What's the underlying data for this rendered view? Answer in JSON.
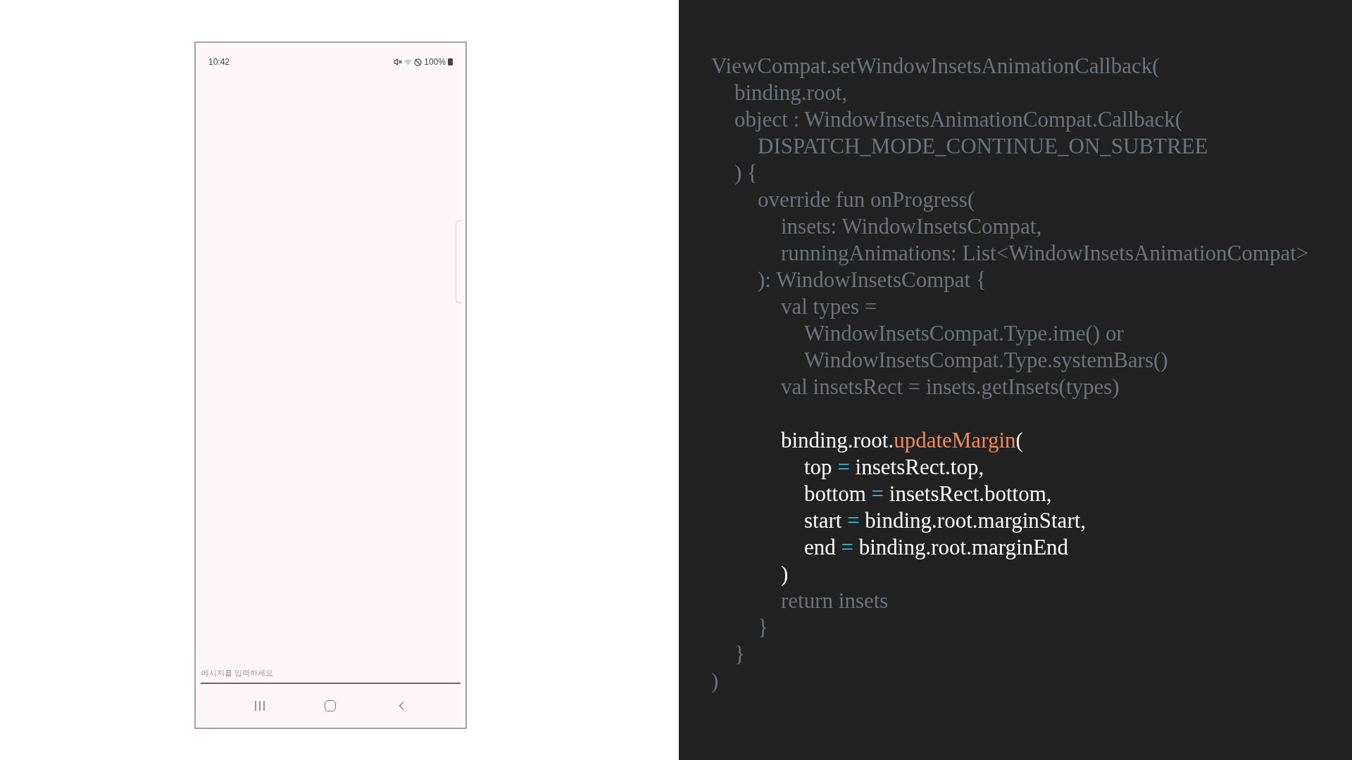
{
  "phone": {
    "status_bar": {
      "time": "10:42",
      "battery": "100%"
    },
    "message_field": {
      "placeholder": "메시지를 입력하세요"
    }
  },
  "code": {
    "lines": [
      {
        "highlighted": false,
        "segments": [
          {
            "kind": "plain",
            "text": "ViewCompat.setWindowInsetsAnimationCallback("
          }
        ],
        "children": [
          {
            "highlighted": false,
            "segments": [
              {
                "kind": "plain",
                "text": "binding.root,"
              }
            ]
          },
          {
            "highlighted": false,
            "segments": [
              {
                "kind": "plain",
                "text": "object : WindowInsetsAnimationCompat.Callback("
              }
            ],
            "children": [
              {
                "highlighted": false,
                "segments": [
                  {
                    "kind": "plain",
                    "text": "DISPATCH_MODE_CONTINUE_ON_SUBTREE"
                  }
                ]
              }
            ]
          },
          {
            "highlighted": false,
            "segments": [
              {
                "kind": "plain",
                "text": ") {"
              }
            ],
            "children": [
              {
                "highlighted": false,
                "segments": [
                  {
                    "kind": "plain",
                    "text": "override fun onProgress("
                  }
                ],
                "children": [
                  {
                    "highlighted": false,
                    "segments": [
                      {
                        "kind": "plain",
                        "text": "insets: WindowInsetsCompat,"
                      }
                    ]
                  },
                  {
                    "highlighted": false,
                    "segments": [
                      {
                        "kind": "plain",
                        "text": "runningAnimations: List<WindowInsetsAnimationCompat>"
                      }
                    ]
                  }
                ]
              },
              {
                "highlighted": false,
                "segments": [
                  {
                    "kind": "plain",
                    "text": "): WindowInsetsCompat {"
                  }
                ],
                "children": [
                  {
                    "highlighted": false,
                    "segments": [
                      {
                        "kind": "plain",
                        "text": "val types ="
                      }
                    ],
                    "children": [
                      {
                        "highlighted": false,
                        "segments": [
                          {
                            "kind": "plain",
                            "text": "WindowInsetsCompat.Type.ime() or"
                          }
                        ]
                      },
                      {
                        "highlighted": false,
                        "segments": [
                          {
                            "kind": "plain",
                            "text": "WindowInsetsCompat.Type.systemBars()"
                          }
                        ]
                      }
                    ]
                  },
                  {
                    "highlighted": false,
                    "segments": [
                      {
                        "kind": "plain",
                        "text": "val insetsRect = insets.getInsets(types)"
                      }
                    ]
                  },
                  {
                    "kind": "blank"
                  },
                  {
                    "highlighted": true,
                    "segments": [
                      {
                        "kind": "plain",
                        "text": "binding.root."
                      },
                      {
                        "kind": "call",
                        "text": "updateMargin"
                      },
                      {
                        "kind": "plain",
                        "text": "("
                      }
                    ],
                    "children": [
                      {
                        "highlighted": true,
                        "segments": [
                          {
                            "kind": "plain",
                            "text": "top "
                          },
                          {
                            "kind": "op",
                            "text": "="
                          },
                          {
                            "kind": "plain",
                            "text": " insetsRect.top,"
                          }
                        ]
                      },
                      {
                        "highlighted": true,
                        "segments": [
                          {
                            "kind": "plain",
                            "text": "bottom "
                          },
                          {
                            "kind": "op",
                            "text": "="
                          },
                          {
                            "kind": "plain",
                            "text": " insetsRect.bottom,"
                          }
                        ]
                      },
                      {
                        "highlighted": true,
                        "segments": [
                          {
                            "kind": "plain",
                            "text": "start "
                          },
                          {
                            "kind": "op",
                            "text": "="
                          },
                          {
                            "kind": "plain",
                            "text": " binding.root.marginStart,"
                          }
                        ]
                      },
                      {
                        "highlighted": true,
                        "segments": [
                          {
                            "kind": "plain",
                            "text": "end "
                          },
                          {
                            "kind": "op",
                            "text": "="
                          },
                          {
                            "kind": "plain",
                            "text": " binding.root.marginEnd"
                          }
                        ]
                      }
                    ]
                  },
                  {
                    "highlighted": true,
                    "segments": [
                      {
                        "kind": "plain",
                        "text": ")"
                      }
                    ]
                  },
                  {
                    "highlighted": false,
                    "segments": [
                      {
                        "kind": "plain",
                        "text": "return insets"
                      }
                    ]
                  }
                ]
              },
              {
                "highlighted": false,
                "segments": [
                  {
                    "kind": "plain",
                    "text": "}"
                  }
                ]
              }
            ]
          },
          {
            "highlighted": false,
            "segments": [
              {
                "kind": "plain",
                "text": "}"
              }
            ]
          }
        ]
      },
      {
        "highlighted": false,
        "segments": [
          {
            "kind": "plain",
            "text": ")"
          }
        ]
      }
    ]
  }
}
